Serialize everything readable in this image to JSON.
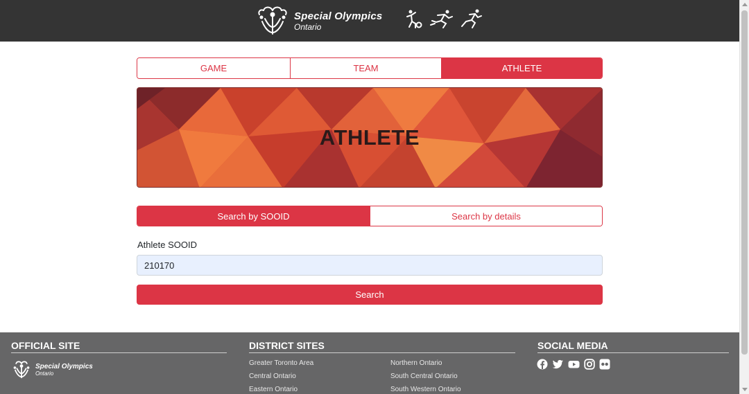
{
  "header": {
    "brand_line1": "Special Olympics",
    "brand_line2": "Ontario"
  },
  "tabs": [
    {
      "label": "GAME",
      "active": false
    },
    {
      "label": "TEAM",
      "active": false
    },
    {
      "label": "ATHLETE",
      "active": true
    }
  ],
  "banner": {
    "title": "ATHLETE"
  },
  "search_mode": {
    "by_sooid": "Search by SOOID",
    "by_details": "Search by details",
    "active": "by_sooid"
  },
  "form": {
    "label": "Athlete SOOID",
    "value": "210170",
    "button": "Search"
  },
  "footer": {
    "official_title": "OFFICIAL SITE",
    "official_logo_line1": "Special Olympics",
    "official_logo_line2": "Ontario",
    "district_title": "DISTRICT SITES",
    "district_links_left": [
      "Greater Toronto Area",
      "Central Ontario",
      "Eastern Ontario"
    ],
    "district_links_right": [
      "Northern Ontario",
      "South Central Ontario",
      "South Western Ontario"
    ],
    "social_title": "SOCIAL MEDIA",
    "social_icons": [
      "facebook-icon",
      "twitter-icon",
      "youtube-icon",
      "instagram-icon",
      "flickr-icon"
    ]
  },
  "colors": {
    "accent": "#dc3545",
    "header_bg": "#343434",
    "footer_bg": "#666667"
  }
}
